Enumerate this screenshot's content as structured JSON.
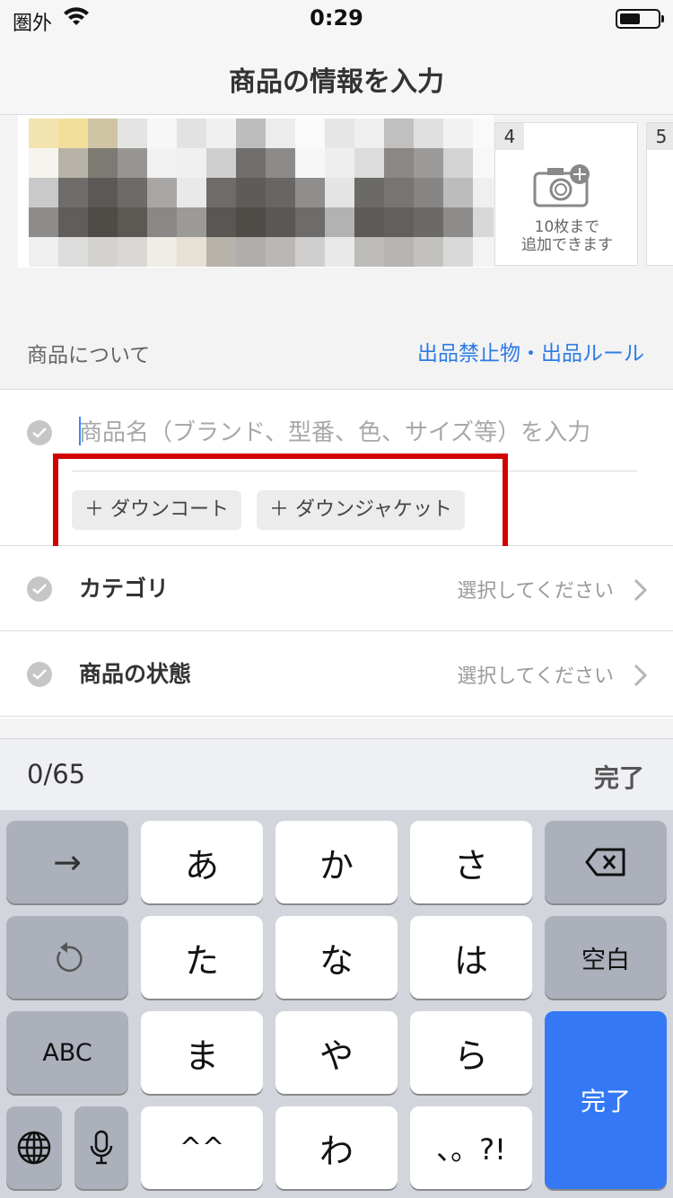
{
  "status_bar": {
    "carrier": "圏外",
    "time": "0:29",
    "wifi_icon": "wifi-icon",
    "battery_icon": "battery-icon"
  },
  "nav": {
    "title": "商品の情報を入力"
  },
  "photos": {
    "slots": [
      {
        "number": "4",
        "text_line1": "10枚まで",
        "text_line2": "追加できます",
        "icon": "camera-add-icon"
      },
      {
        "number": "5"
      }
    ]
  },
  "section": {
    "title": "商品について",
    "link": "出品禁止物・出品ルール"
  },
  "form": {
    "name_placeholder": "商品名（ブランド、型番、色、サイズ等）を入力",
    "name_value": "",
    "suggestions": [
      "＋ ダウンコート",
      "＋ ダウンジャケット"
    ],
    "rows": [
      {
        "label": "カテゴリ",
        "value": "選択してください"
      },
      {
        "label": "商品の状態",
        "value": "選択してください"
      }
    ]
  },
  "accessory": {
    "counter": "0/65",
    "done": "完了"
  },
  "keyboard": {
    "keys": {
      "next": "→",
      "a": "あ",
      "ka": "か",
      "sa": "さ",
      "ta": "た",
      "na": "な",
      "ha": "は",
      "ma": "ま",
      "ya": "や",
      "ra": "ら",
      "emoticon": "^^",
      "wa": "わ",
      "punct": "、。?!",
      "space": "空白",
      "abc": "ABC",
      "done": "完了"
    }
  },
  "colors": {
    "accent_blue": "#2d7be5",
    "highlight_red": "#d30000",
    "keyboard_blue": "#3478f6"
  }
}
